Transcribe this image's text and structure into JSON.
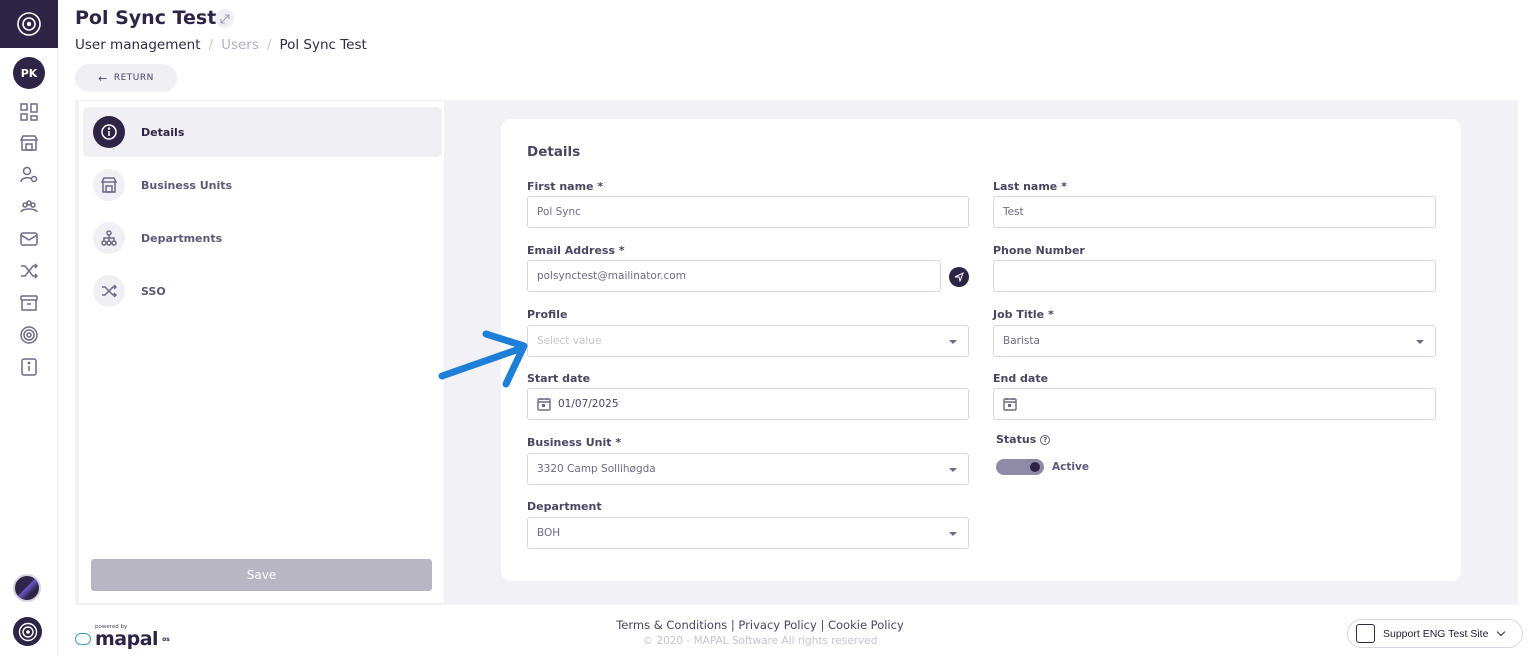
{
  "header": {
    "title": "Pol Sync Test",
    "breadcrumb": [
      "User management",
      "Users",
      "Pol Sync Test"
    ],
    "return_label": "RETURN"
  },
  "rail": {
    "avatar_initials": "PK",
    "icons": [
      "dashboard-icon",
      "store-icon",
      "user-settings-icon",
      "team-icon",
      "mail-icon",
      "shuffle-icon",
      "archive-icon",
      "target-icon",
      "info-icon"
    ]
  },
  "side_nav": {
    "items": [
      {
        "label": "Details",
        "icon": "info-icon",
        "active": true
      },
      {
        "label": "Business Units",
        "icon": "store-icon",
        "active": false
      },
      {
        "label": "Departments",
        "icon": "org-chart-icon",
        "active": false
      },
      {
        "label": "SSO",
        "icon": "shuffle-icon",
        "active": false
      }
    ],
    "save_label": "Save"
  },
  "form": {
    "title": "Details",
    "first_name": {
      "label": "First name *",
      "value": "Pol Sync"
    },
    "last_name": {
      "label": "Last name *",
      "value": "Test"
    },
    "email": {
      "label": "Email Address *",
      "value": "polsynctest@mailinator.com"
    },
    "phone": {
      "label": "Phone Number",
      "value": ""
    },
    "profile": {
      "label": "Profile",
      "placeholder": "Select value"
    },
    "job_title": {
      "label": "Job Title *",
      "value": "Barista"
    },
    "start_date": {
      "label": "Start date",
      "value": "01/07/2025"
    },
    "end_date": {
      "label": "End date",
      "value": ""
    },
    "business_unit": {
      "label": "Business Unit *",
      "value": "3320 Camp Sollihøgda"
    },
    "status": {
      "label": "Status",
      "value": "Active",
      "enabled": true
    },
    "department": {
      "label": "Department",
      "value": "BOH"
    }
  },
  "footer": {
    "powered_by": "powered by",
    "brand": "mapal",
    "brand_sup": "os",
    "links": "Terms & Conditions | Privacy Policy | Cookie Policy",
    "copyright": "© 2020 - MAPAL Software All rights reserved",
    "site_selector": "Support ENG Test Site"
  },
  "colors": {
    "primary": "#2e2446",
    "annotation_arrow": "#1e7fd6",
    "page_bg": "#f2f2f6"
  }
}
